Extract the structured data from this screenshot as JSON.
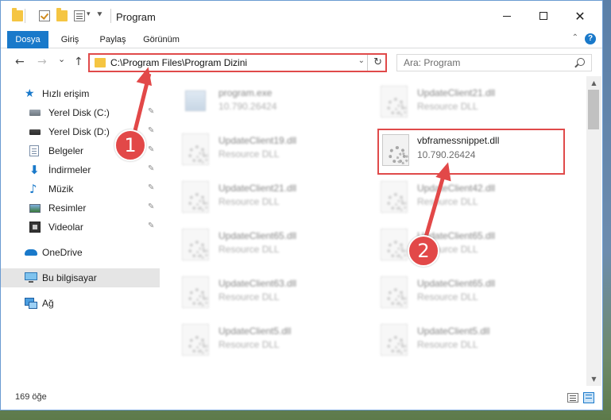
{
  "window": {
    "title": "Program",
    "minimize_label": "",
    "maximize_label": "",
    "close_label": "✕"
  },
  "ribbon": {
    "tabs": [
      "Dosya",
      "Giriş",
      "Paylaş",
      "Görünüm"
    ],
    "collapse_glyph": "⌃",
    "help_glyph": "?"
  },
  "nav": {
    "back": "←",
    "forward": "→",
    "recent": "⌄",
    "up": "↑",
    "address": "C:\\Program Files\\Program Dizini",
    "address_dropdown": "⌄",
    "refresh": "↻",
    "search_placeholder": "Ara: Program"
  },
  "sidebar": {
    "quick_access": "Hızlı erişim",
    "items": [
      {
        "label": "Yerel Disk (C:)",
        "icon": "drive-icon",
        "pinned": true
      },
      {
        "label": "Yerel Disk (D:)",
        "icon": "drive-icon",
        "pinned": true
      },
      {
        "label": "Belgeler",
        "icon": "documents-icon",
        "pinned": true
      },
      {
        "label": "İndirmeler",
        "icon": "downloads-icon",
        "pinned": true
      },
      {
        "label": "Müzik",
        "icon": "music-icon",
        "pinned": true
      },
      {
        "label": "Resimler",
        "icon": "pictures-icon",
        "pinned": true
      },
      {
        "label": "Videolar",
        "icon": "videos-icon",
        "pinned": true
      }
    ],
    "onedrive": "OneDrive",
    "this_pc": "Bu bilgisayar",
    "network": "Ağ",
    "pin_glyph": "📌"
  },
  "files": {
    "left": [
      {
        "name": "program.exe",
        "desc": "10.790.26424"
      },
      {
        "name": "UpdateClient19.dll",
        "desc": "Resource DLL"
      },
      {
        "name": "UpdateClient21.dll",
        "desc": "Resource DLL"
      },
      {
        "name": "UpdateClient65.dll",
        "desc": "Resource DLL"
      },
      {
        "name": "UpdateClient63.dll",
        "desc": "Resource DLL"
      },
      {
        "name": "UpdateClient5.dll",
        "desc": "Resource DLL"
      }
    ],
    "right": [
      {
        "name": "UpdateClient21.dll",
        "desc": "Resource DLL"
      },
      {
        "name": "vbframessnippet.dll",
        "desc": "10.790.26424"
      },
      {
        "name": "UpdateClient42.dll",
        "desc": "Resource DLL"
      },
      {
        "name": "UpdateClient65.dll",
        "desc": "Resource DLL"
      },
      {
        "name": "UpdateClient65.dll",
        "desc": "Resource DLL"
      },
      {
        "name": "UpdateClient5.dll",
        "desc": "Resource DLL"
      }
    ]
  },
  "status": {
    "count": "169 öğe"
  },
  "annotations": {
    "step1": "1",
    "step2": "2",
    "color": "#e24848"
  },
  "scrollbar": {
    "up": "▲",
    "down": "▼"
  }
}
